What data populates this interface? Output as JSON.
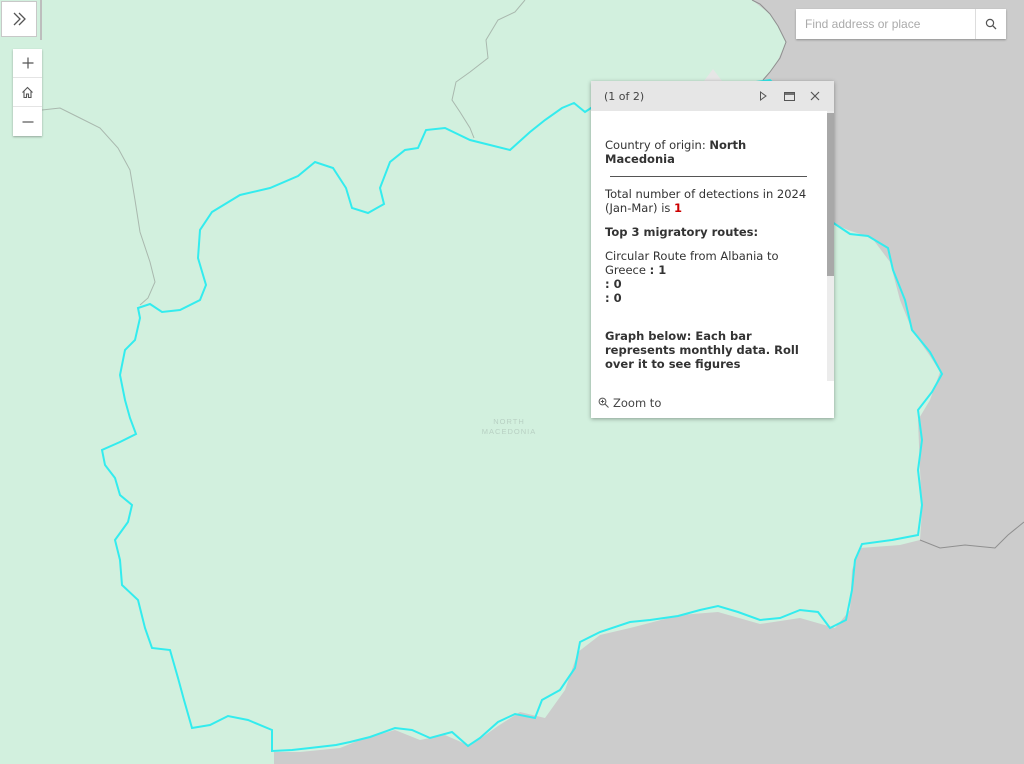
{
  "map": {
    "country_label_line1": "NORTH",
    "country_label_line2": "MACEDONIA",
    "colors": {
      "land_fill": "#d2f0de",
      "outside_fill": "#cccccc",
      "selection_outline": "#33ecee",
      "border_line": "#9a9a9a"
    }
  },
  "controls": {
    "sidebar_toggle_icon": "double-chevron-right-icon",
    "zoom_in_icon": "plus-icon",
    "home_icon": "home-icon",
    "zoom_out_icon": "minus-icon"
  },
  "search": {
    "placeholder": "Find address or place",
    "icon": "search-icon"
  },
  "popup": {
    "pager": "(1 of 2)",
    "origin_label": "Country of origin: ",
    "origin_value": "North Macedonia",
    "detections_text": "Total number of detections in 2024 (Jan-Mar) is ",
    "detections_value": "1",
    "routes_heading": "Top 3 migratory routes:",
    "routes": [
      {
        "name": "Circular Route from Albania to Greece",
        "value": "1"
      },
      {
        "name": "",
        "value": "0"
      },
      {
        "name": "",
        "value": "0"
      }
    ],
    "graph_note": "Graph below: Each bar represents monthly data. Roll over it to see figures",
    "zoom_to_label": "Zoom to",
    "colors": {
      "highlight": "#cc0000"
    }
  }
}
